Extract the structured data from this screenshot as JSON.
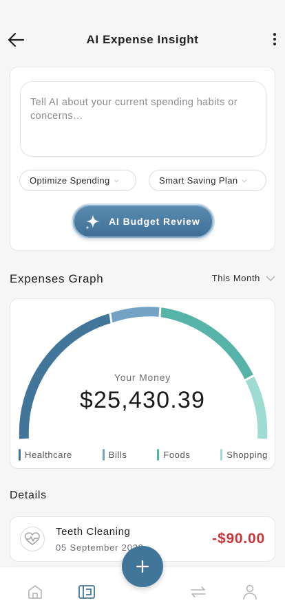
{
  "header": {
    "title": "AI Expense Insight",
    "back_icon": "arrow-left-icon",
    "more_icon": "more-vertical-icon"
  },
  "ai_card": {
    "placeholder": "Tell AI about your current spending habits or concerns…",
    "chips": [
      {
        "label": "Optimize Spending"
      },
      {
        "label": "Smart Saving Plan"
      }
    ],
    "action_button": "AI Budget Review",
    "action_icon": "sparkle-icon"
  },
  "graph": {
    "title": "Expenses Graph",
    "period": "This Month",
    "center_label": "Your Money",
    "center_value": "$25,430.39",
    "legend": [
      {
        "label": "Healthcare",
        "color": "#41769a"
      },
      {
        "label": "Bills",
        "color": "#72a3c4"
      },
      {
        "label": "Foods",
        "color": "#55b4a7"
      },
      {
        "label": "Shopping",
        "color": "#9edbd2"
      }
    ]
  },
  "details": {
    "title": "Details",
    "items": [
      {
        "name": "Teeth Cleaning",
        "date": "05 September 2023",
        "amount": "-$90.00",
        "icon": "heart-pulse-icon"
      }
    ]
  },
  "bottom_nav": {
    "items": [
      "home-icon",
      "wallet-icon",
      "transfer-icon",
      "profile-icon"
    ],
    "fab_icon": "plus-icon"
  },
  "colors": {
    "accent": "#41769a",
    "expense_red": "#c8373a"
  }
}
